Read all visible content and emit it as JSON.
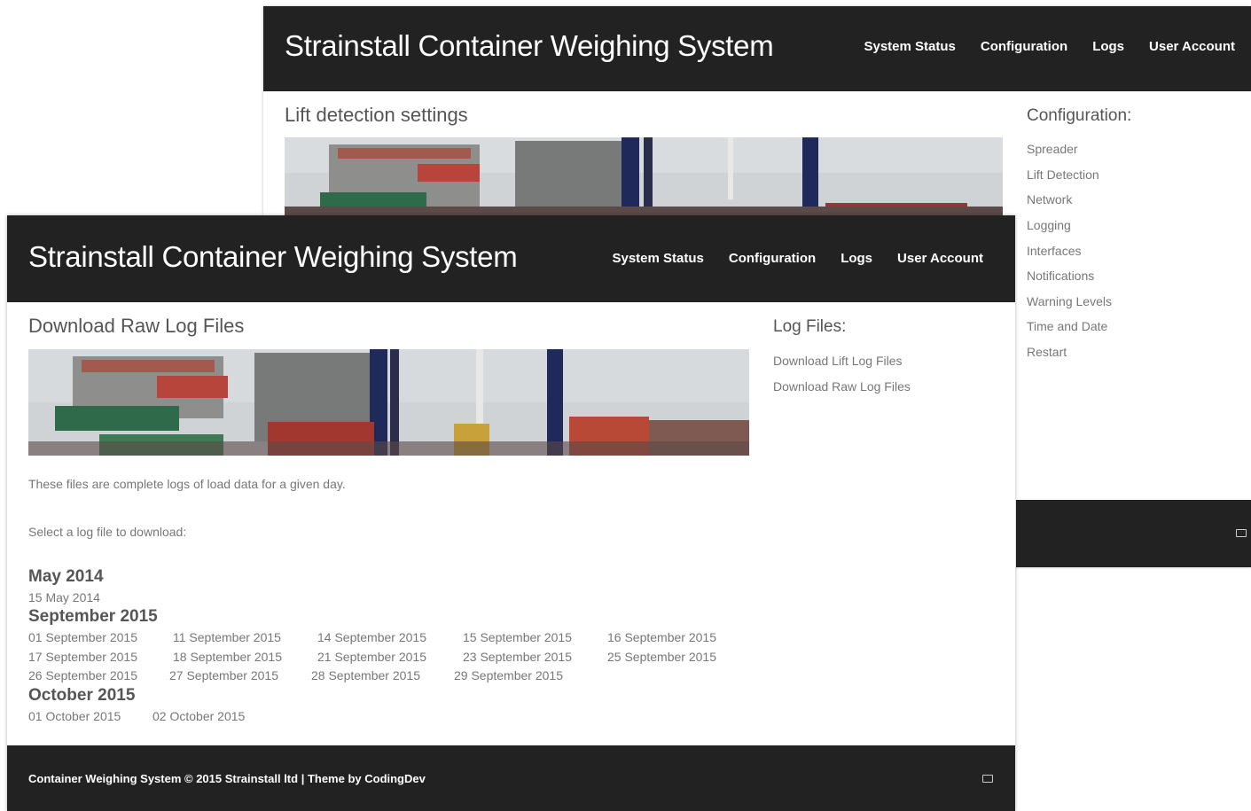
{
  "back_window": {
    "brand": "Strainstall Container Weighing System",
    "nav": [
      "System Status",
      "Configuration",
      "Logs",
      "User Account"
    ],
    "page_title": "Lift detection settings",
    "sidebar_title": "Configuration:",
    "sidebar_links": [
      "Spreader",
      "Lift Detection",
      "Network",
      "Logging",
      "Interfaces",
      "Notifications",
      "Warning Levels",
      "Time and Date",
      "Restart"
    ]
  },
  "front_window": {
    "brand": "Strainstall Container Weighing System",
    "nav": [
      "System Status",
      "Configuration",
      "Logs",
      "User Account"
    ],
    "page_title": "Download Raw Log Files",
    "sidebar_title": "Log Files:",
    "sidebar_links": [
      "Download Lift Log Files",
      "Download Raw Log Files"
    ],
    "description": "These files are complete logs of load data for a given day.",
    "instruction": "Select a log file to download:",
    "groups": [
      {
        "month": "May 2014",
        "files": [
          "15 May 2014"
        ]
      },
      {
        "month": "September 2015",
        "files": [
          "01 September 2015",
          "11 September 2015",
          "14 September 2015",
          "15 September 2015",
          "16 September 2015",
          "17 September 2015",
          "18 September 2015",
          "21 September 2015",
          "23 September 2015",
          "25 September 2015",
          "26 September 2015",
          "27 September 2015",
          "28 September 2015",
          "29 September 2015"
        ]
      },
      {
        "month": "October 2015",
        "files": [
          "01 October 2015",
          "02 October 2015"
        ]
      }
    ],
    "footer": "Container Weighing System © 2015 Strainstall ltd | Theme by CodingDev"
  },
  "colors": {
    "navbar": "#222222",
    "text": "#555555",
    "link": "#777777"
  }
}
